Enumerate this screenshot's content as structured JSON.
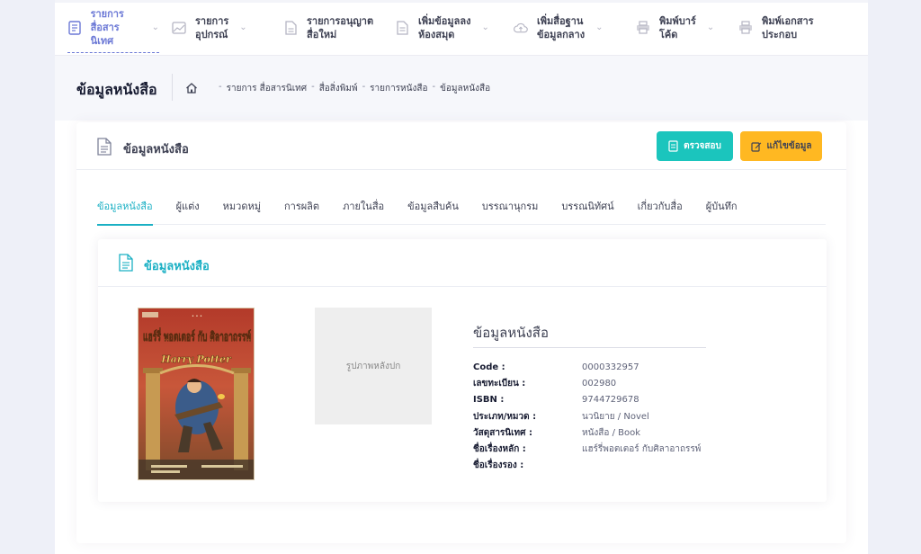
{
  "nav": {
    "items": [
      {
        "label": "รายการ\nสื่อสารนิเทศ",
        "icon": "document-list-icon",
        "active": true
      },
      {
        "label": "รายการ\nอุปกรณ์",
        "icon": "image-icon"
      },
      {
        "label": "รายการอนุญาต\nสื่อใหม่",
        "icon": "document-icon"
      },
      {
        "label": "เพิ่มข้อมูลลง\nห้องสมุด",
        "icon": "document-add-icon"
      },
      {
        "label": "เพิ่มสื่อฐาน\nข้อมูลกลาง",
        "icon": "cloud-upload-icon"
      },
      {
        "label": "พิมพ์บาร์\nโค้ด",
        "icon": "printer-icon"
      },
      {
        "label": "พิมพ์เอกสาร\nประกอบ",
        "icon": "printer-icon"
      }
    ]
  },
  "subheader": {
    "title": "ข้อมูลหนังสือ",
    "breadcrumb": [
      "รายการ สื่อสารนิเทศ",
      "สื่อสิ่งพิมพ์",
      "รายการหนังสือ",
      "ข้อมูลหนังสือ"
    ]
  },
  "card": {
    "title": "ข้อมูลหนังสือ",
    "check_button": "ตรวจสอบ",
    "edit_button": "แก้ไขข้อมูล"
  },
  "tabs": [
    "ข้อมูลหนังสือ",
    "ผู้แต่ง",
    "หมวดหมู่",
    "การผลิต",
    "ภายในสื่อ",
    "ข้อมูลสืบค้น",
    "บรรณานุกรม",
    "บรรณนิทัศน์",
    "เกี่ยวกับสื่อ",
    "ผู้บันทึก"
  ],
  "inner": {
    "title": "ข้อมูลหนังสือ",
    "cover_title": "แฮร์รี่ พอตเตอร์ กับ ศิลาอาถรรพ์",
    "cover_title_en": "Harry Potter",
    "back_cover_label": "รูปภาพหลังปก",
    "info_title": "ข้อมูลหนังสือ",
    "rows": [
      {
        "label": "Code :",
        "value": "0000332957"
      },
      {
        "label": "เลขทะเบียน :",
        "value": "002980"
      },
      {
        "label": "ISBN :",
        "value": "9744729678"
      },
      {
        "label": "ประเภท/หมวด :",
        "value": "นวนิยาย / Novel"
      },
      {
        "label": "วัสดุสารนิเทศ :",
        "value": "หนังสือ / Book"
      },
      {
        "label": "ชื่อเรื่องหลัก :",
        "value": "แฮร์รี่พอตเตอร์ กับศิลาอาถรรพ์"
      },
      {
        "label": "ชื่อเรื่องรอง :",
        "value": ""
      }
    ]
  },
  "colors": {
    "accent": "#1bb0c4",
    "nav_active": "#6c79d6",
    "check_button": "#1bc5bd",
    "edit_button": "#ffb822"
  }
}
